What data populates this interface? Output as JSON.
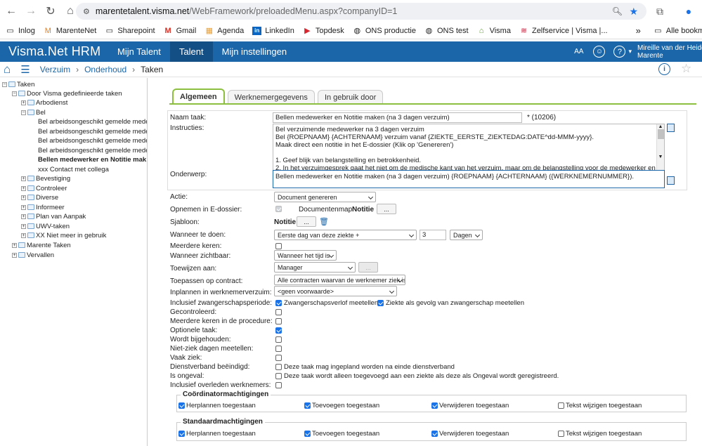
{
  "browser": {
    "url_host": "marentetalent.visma.net",
    "url_path": "/WebFramework/preloadedMenu.aspx?companyID=1",
    "bookmarks": [
      "Inlog",
      "MarenteNet",
      "Sharepoint",
      "Gmail",
      "Agenda",
      "LinkedIn",
      "Topdesk",
      "ONS productie",
      "ONS test",
      "Visma",
      "Zelfservice | Visma |...",
      "Alle bookma"
    ],
    "overflow_label": "»"
  },
  "app": {
    "title": "Visma.Net HRM",
    "nav": [
      "Mijn Talent",
      "Talent",
      "Mijn instellingen"
    ],
    "font_size_label": "AA",
    "help_label": "?",
    "user_line1": "Mireille van der Heide",
    "user_line2": "Marente"
  },
  "breadcrumb": {
    "items": [
      "Verzuim",
      "Onderhoud",
      "Taken"
    ],
    "separator": "›"
  },
  "tree": [
    {
      "label": "Taken",
      "expander": "−"
    },
    {
      "label": "Door Visma gedefinieerde taken",
      "expander": "−"
    },
    {
      "label": "Arbodienst",
      "expander": "+"
    },
    {
      "label": "Bel",
      "expander": "−"
    },
    {
      "label": "Bel arbeidsongeschikt gemelde medev"
    },
    {
      "label": "Bel arbeidsongeschikt gemelde medev"
    },
    {
      "label": "Bel arbeidsongeschikt gemelde medev"
    },
    {
      "label": "Bel arbeidsongeschikt gemelde medev"
    },
    {
      "label": "Bellen medewerker en Notitie mak"
    },
    {
      "label": "xxx Contact met collega"
    },
    {
      "label": "Bevestiging",
      "expander": "+"
    },
    {
      "label": "Controleer",
      "expander": "+"
    },
    {
      "label": "Diverse",
      "expander": "+"
    },
    {
      "label": "Informeer",
      "expander": "+"
    },
    {
      "label": "Plan van Aanpak",
      "expander": "+"
    },
    {
      "label": "UWV-taken",
      "expander": "+"
    },
    {
      "label": "XX Niet meer in gebruik",
      "expander": "+"
    },
    {
      "label": "Marente Taken",
      "expander": "+"
    },
    {
      "label": "Vervallen",
      "expander": "+"
    }
  ],
  "tabs": [
    "Algemeen",
    "Werknemergegevens",
    "In gebruik door"
  ],
  "form": {
    "naam_label": "Naam taak:",
    "naam_value": "Bellen medewerker en Notitie maken (na 3 dagen verzuim)",
    "naam_suffix": "* (10206)",
    "instructies_label": "Instructies:",
    "instructies_lines": [
      "Bel verzuimende medewerker na 3 dagen verzuim",
      "Bel {ROEPNAAM} {ACHTERNAAM} verzuim vanaf {ZIEKTE_EERSTE_ZIEKTEDAG:DATE^dd-MMM-yyyy}.",
      "Maak direct een notitie in het E-dossier (Klik op 'Genereren')",
      "",
      "1. Geef blijk van belangstelling en betrokkenheid.",
      "2. In het verzuimgesprek gaat het niet om de medische kant van het verzuim, maar om de belangstelling voor de medewerker en"
    ],
    "onderwerp_label": "Onderwerp:",
    "onderwerp_value": "Bellen medewerker en Notitie maken (na 3 dagen verzuim) {ROEPNAAM} {ACHTERNAAM} ({WERKNEMERNUMMER}).",
    "actie_label": "Actie:",
    "actie_value": "Document genereren",
    "opnemen_label": "Opnemen in E-dossier:",
    "documentenmap_label": "Documentenmap:",
    "documentenmap_value": "Notitie",
    "browse_label": "...",
    "sjabloon_label": "Sjabloon:",
    "sjabloon_value": "Notitie",
    "wanneer_label": "Wanneer te doen:",
    "wanneer_value": "Eerste dag van deze ziekte +",
    "wanneer_days": "3",
    "wanneer_unit": "Dagen",
    "meerdere_label": "Meerdere keren:",
    "zichtbaar_label": "Wanneer zichtbaar:",
    "zichtbaar_value": "Wanneer het tijd is",
    "toewijzen_label": "Toewijzen aan:",
    "toewijzen_value": "Manager",
    "contract_label": "Toepassen op contract:",
    "contract_value": "Alle contracten waarvan de werknemer ziek is.",
    "inplannen_label": "Inplannen in werknemerverzuim:",
    "inplannen_value": "<geen voorwaarde>",
    "zwanger_label": "Inclusief zwangerschapsperiode:",
    "zwanger_opt1": "Zwangerschapsverlof meetellen",
    "zwanger_opt2": "Ziekte als gevolg van zwangerschap meetellen",
    "gecontroleerd_label": "Gecontroleerd:",
    "procedure_label": "Meerdere keren in de procedure:",
    "optioneel_label": "Optionele taak:",
    "bijgehouden_label": "Wordt bijgehouden:",
    "nietziek_label": "Niet-ziek dagen meetellen:",
    "vaakziek_label": "Vaak ziek:",
    "dienstverband_label": "Dienstverband beëindigd:",
    "dienstverband_text": "Deze taak mag ingepland worden na einde dienstverband",
    "ongeval_label": "Is ongeval:",
    "ongeval_text": "Deze taak wordt alleen toegevoegd aan een ziekte als deze als Ongeval wordt geregistreerd.",
    "overleden_label": "Inclusief overleden werknemers:"
  },
  "coordinator": {
    "title": "Coördinatormachtigingen",
    "items": [
      "Herplannen toegestaan",
      "Toevoegen toegestaan",
      "Verwijderen toegestaan",
      "Tekst wijzigen toegestaan"
    ]
  },
  "standaard": {
    "title": "Standaardmachtigingen",
    "items": [
      "Herplannen toegestaan",
      "Toevoegen toegestaan",
      "Verwijderen toegestaan",
      "Tekst wijzigen toegestaan"
    ]
  },
  "colors": {
    "brand": "#1b66a8",
    "accent": "#8cbf3f",
    "check": "#1a73e8"
  }
}
